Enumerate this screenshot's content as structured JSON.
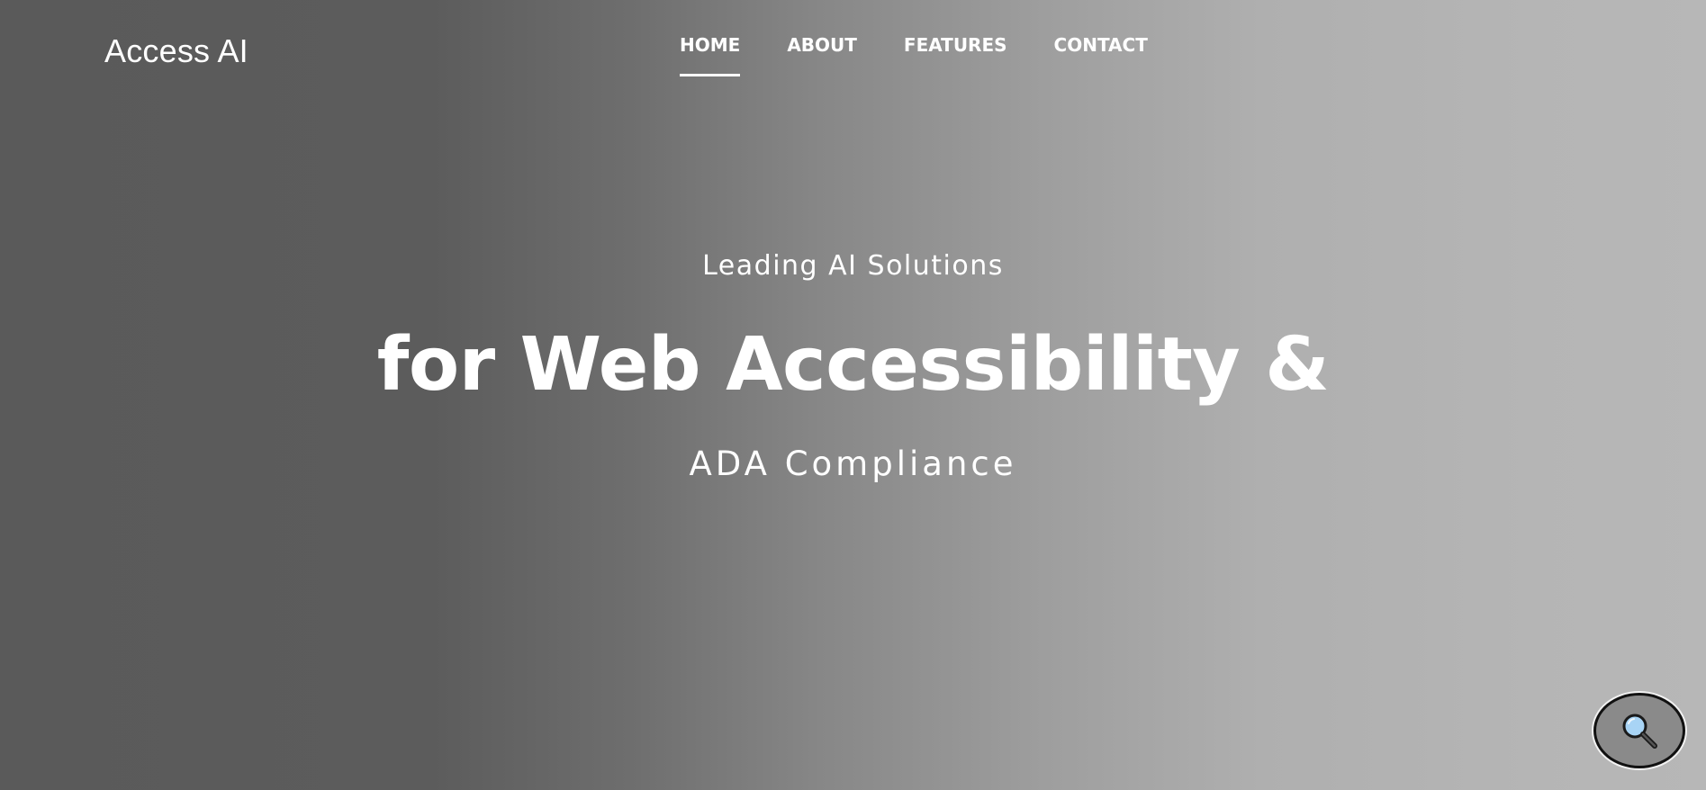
{
  "brand": {
    "logo_text": "Access AI"
  },
  "nav": {
    "items": [
      {
        "label": "HOME",
        "active": true
      },
      {
        "label": "ABOUT",
        "active": false
      },
      {
        "label": "FEATURES",
        "active": false
      },
      {
        "label": "CONTACT",
        "active": false
      }
    ]
  },
  "hero": {
    "subtitle": "Leading AI Solutions",
    "title": "for Web Accessibility &",
    "tagline": "ADA Compliance"
  },
  "widgets": {
    "accessibility_button_icon": "magnifier-icon"
  },
  "colors": {
    "text": "#ffffff",
    "gradient_dark": "#5a5a5a",
    "gradient_light": "#b7b7b7",
    "widget_bg": "#8a8a8a",
    "magnifier_lens": "#a8d4f5"
  }
}
